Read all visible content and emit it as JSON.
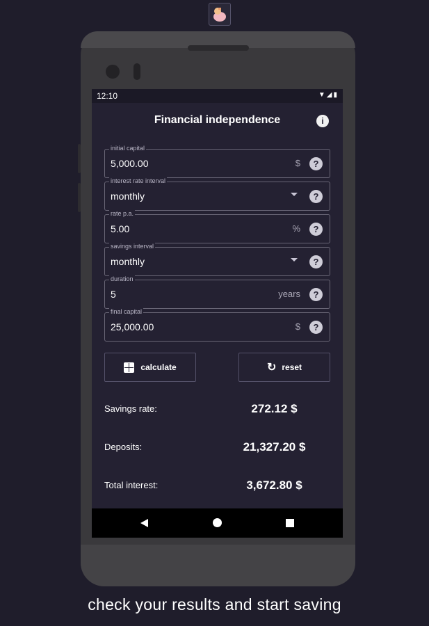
{
  "status_bar": {
    "time": "12:10",
    "icons": "▼◢▮"
  },
  "header": {
    "title": "Financial independence",
    "info_icon": "i"
  },
  "fields": [
    {
      "label": "initial capital",
      "value": "5,000.00",
      "suffix": "$",
      "type": "input"
    },
    {
      "label": "interest rate interval",
      "value": "monthly",
      "suffix": "",
      "type": "dropdown"
    },
    {
      "label": "rate p.a.",
      "value": "5.00",
      "suffix": "%",
      "type": "input"
    },
    {
      "label": "savings interval",
      "value": "monthly",
      "suffix": "",
      "type": "dropdown"
    },
    {
      "label": "duration",
      "value": "5",
      "suffix": "years",
      "type": "input"
    },
    {
      "label": "final capital",
      "value": "25,000.00",
      "suffix": "$",
      "type": "input"
    }
  ],
  "help_icon": "?",
  "buttons": {
    "calculate": "calculate",
    "reset": "reset",
    "reset_icon": "↻"
  },
  "results": [
    {
      "label": "Savings rate:",
      "value": "272.12 $"
    },
    {
      "label": "Deposits:",
      "value": "21,327.20 $"
    },
    {
      "label": "Total interest:",
      "value": "3,672.80 $"
    }
  ],
  "caption": "check your results and start saving",
  "colors": {
    "background": "#1f1d2b",
    "screen": "#242132",
    "phone": "#3a393c"
  }
}
